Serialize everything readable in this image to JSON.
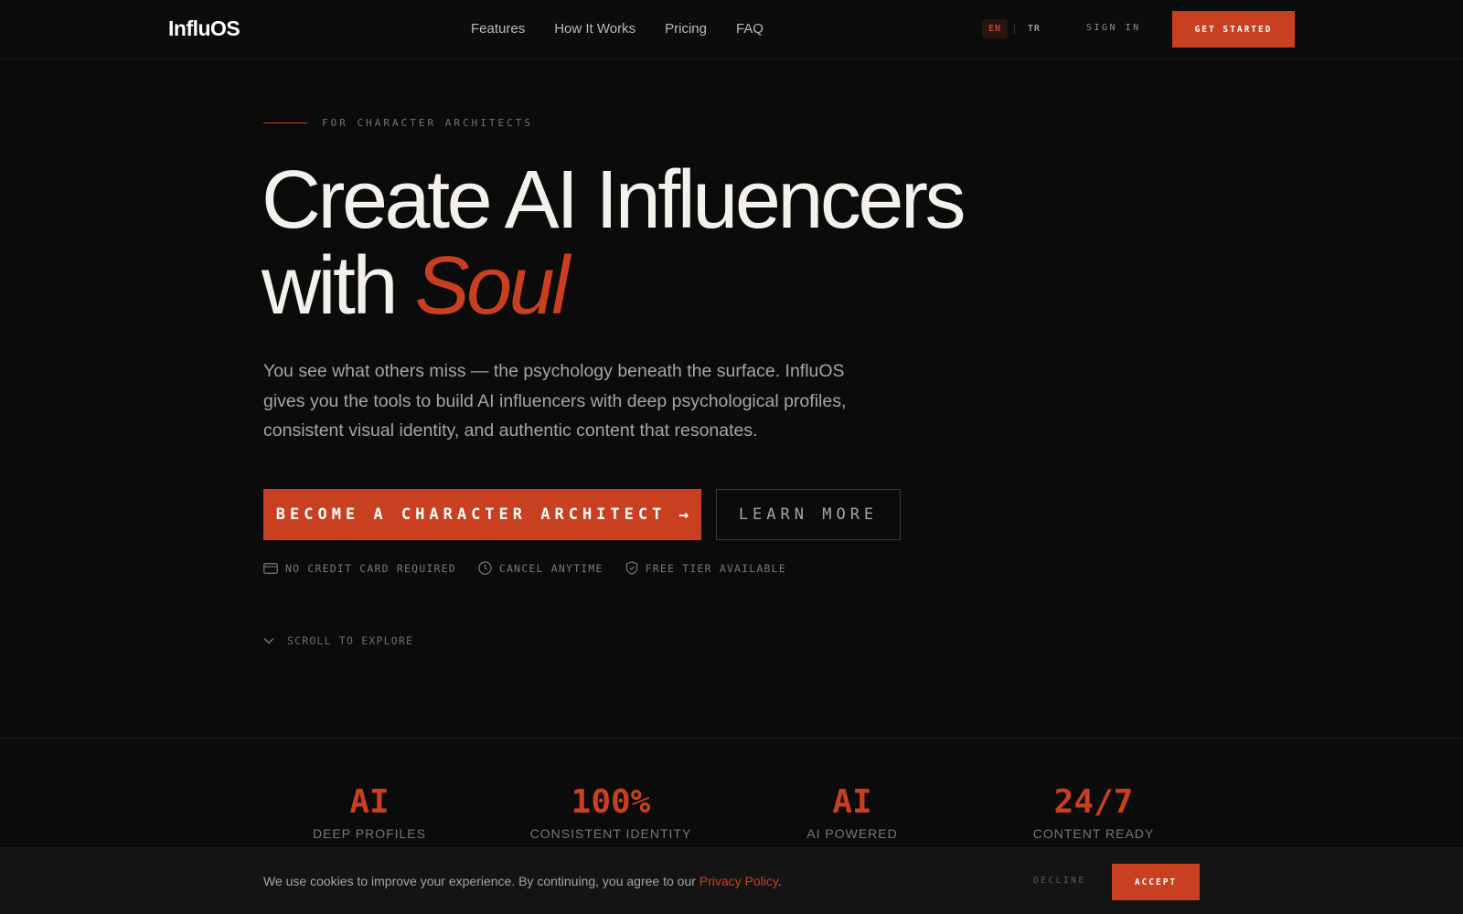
{
  "brand": {
    "logo": "InfluOS"
  },
  "nav": {
    "links": [
      "Features",
      "How It Works",
      "Pricing",
      "FAQ"
    ],
    "lang_active": "EN",
    "lang_sep": "|",
    "lang_other": "TR",
    "signin": "SIGN IN",
    "get_started": "GET STARTED"
  },
  "hero": {
    "eyebrow": "FOR CHARACTER ARCHITECTS",
    "title_line1": "Create AI Influencers",
    "title_line2_prefix": "with ",
    "title_accent": "Soul",
    "subtitle": "You see what others miss — the psychology beneath the surface. InfluOS gives you the tools to build AI influencers with deep psychological profiles, consistent visual identity, and authentic content that resonates.",
    "cta_primary": "BECOME A CHARACTER ARCHITECT",
    "cta_primary_icon": "→",
    "cta_secondary": "LEARN MORE",
    "badges": [
      {
        "icon": "credit-card-icon",
        "label": "NO CREDIT CARD REQUIRED"
      },
      {
        "icon": "clock-icon",
        "label": "CANCEL ANYTIME"
      },
      {
        "icon": "shield-check-icon",
        "label": "FREE TIER AVAILABLE"
      }
    ],
    "scroll": "SCROLL TO EXPLORE"
  },
  "stats": [
    {
      "value": "AI",
      "label": "DEEP PROFILES"
    },
    {
      "value": "100%",
      "label": "CONSISTENT IDENTITY"
    },
    {
      "value": "AI",
      "label": "AI POWERED"
    },
    {
      "value": "24/7",
      "label": "CONTENT READY"
    }
  ],
  "cookie": {
    "text": "We use cookies to improve your experience. By continuing, you agree to our ",
    "link": "Privacy Policy",
    "end": ".",
    "decline": "DECLINE",
    "accept": "ACCEPT"
  },
  "colors": {
    "accent": "#c8401f",
    "background": "#0b0b0b"
  }
}
